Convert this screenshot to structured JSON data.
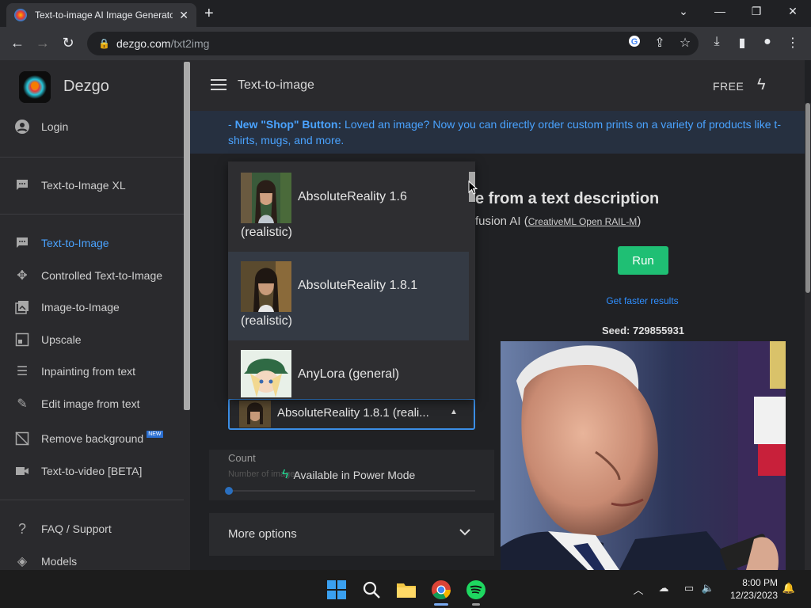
{
  "browser": {
    "tab_title": "Text-to-image AI Image Generator",
    "url_host": "dezgo.com",
    "url_path": "/txt2img"
  },
  "sidebar": {
    "brand": "Dezgo",
    "login": "Login",
    "items": [
      {
        "label": "Text-to-Image XL"
      },
      {
        "label": "Text-to-Image"
      },
      {
        "label": "Controlled Text-to-Image"
      },
      {
        "label": "Image-to-Image"
      },
      {
        "label": "Upscale"
      },
      {
        "label": "Inpainting from text"
      },
      {
        "label": "Edit image from text"
      },
      {
        "label": "Remove background"
      },
      {
        "label": "Text-to-video [BETA]"
      },
      {
        "label": "FAQ / Support"
      },
      {
        "label": "Models"
      }
    ],
    "new_badge": "NEW"
  },
  "header": {
    "title": "Text-to-image",
    "plan": "FREE"
  },
  "notice": {
    "prefix": "- ",
    "strong": "New \"Shop\" Button:",
    "text": " Loved an image? Now you can directly order custom prints on a variety of products like t-shirts, mugs, and more."
  },
  "main": {
    "headline": "e from a text description",
    "subline": "fusion AI (",
    "license": "CreativeML Open RAIL-M",
    "subline_end": ")",
    "run": "Run",
    "faster": "Get faster results",
    "seed": "Seed: 729855931"
  },
  "model_dropdown": {
    "options": [
      {
        "line1": "AbsoluteReality 1.6",
        "line2": "(realistic)"
      },
      {
        "line1": "AbsoluteReality 1.8.1",
        "line2": "(realistic)"
      },
      {
        "line1": "AnyLora (general)",
        "line2": ""
      }
    ],
    "selected": "AbsoluteReality 1.8.1 (reali..."
  },
  "count": {
    "label": "Count",
    "sub": "Number of images",
    "power_mode": "Available in Power Mode"
  },
  "more_options": "More options",
  "taskbar": {
    "time": "8:00 PM",
    "date": "12/23/2023"
  },
  "colors": {
    "accent": "#4aa3ff",
    "run_button": "#1fbf74",
    "sidebar_bg": "#2a2a2d"
  }
}
